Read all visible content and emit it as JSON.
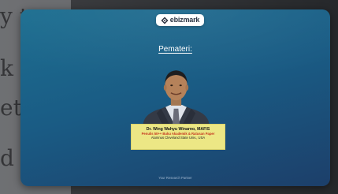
{
  "background_document": {
    "visible_fragments": [
      "y t",
      "k",
      "et",
      "d"
    ]
  },
  "slide": {
    "logo": {
      "text": "ebizmark",
      "icon": "ebizmark-logo-icon"
    },
    "section_title": "Pemateri:",
    "speaker": {
      "name": "Dr. Wing Wahyu Winarno, MAFIS",
      "role": "Penulis 50++ Buku Akademik & Ratusan Paper",
      "alumni": "Alumnus Cleveland State Univ., USA"
    },
    "tagline": "Your Research Partner"
  },
  "colors": {
    "card_gradient_start": "#1d6f91",
    "card_gradient_end": "#1c3f6a",
    "name_box_bg": "#ece785",
    "role_text": "#c6361f"
  }
}
